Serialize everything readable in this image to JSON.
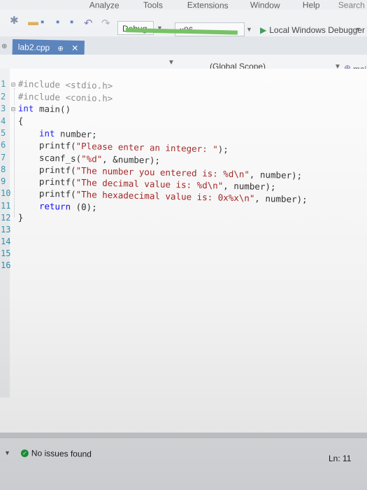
{
  "menu": {
    "items": [
      "Analyze",
      "Tools",
      "Extensions",
      "Window",
      "Help"
    ],
    "search": "Search"
  },
  "toolbar": {
    "config": "Debug",
    "platform": "x86",
    "run_label": "Local Windows Debugger"
  },
  "tab": {
    "filename": "lab2.cpp",
    "pin": "⊕",
    "close": "✕"
  },
  "navbar": {
    "scope": "(Global Scope)",
    "member": "main()"
  },
  "editor": {
    "line_numbers": [
      "1",
      "2",
      "3",
      "4",
      "5",
      "6",
      "7",
      "8",
      "9",
      "10",
      "11",
      "12",
      "13",
      "14",
      "15",
      "16"
    ],
    "lines": [
      {
        "code": "#include <stdio.h>"
      },
      {
        "code": "#include <conio.h>"
      },
      {
        "code": "int main()"
      },
      {
        "code": "{"
      },
      {
        "code": "    int number;"
      },
      {
        "code": "    printf(\"Please enter an integer: \");"
      },
      {
        "code": "    scanf_s(\"%d\", &number);"
      },
      {
        "code": "    printf(\"The number you entered is: %d\\n\", number);"
      },
      {
        "code": "    printf(\"The decimal value is: %d\\n\", number);"
      },
      {
        "code": "    printf(\"The hexadecimal value is: 0x%x\\n\", number);"
      },
      {
        "code": "    return (0);"
      },
      {
        "code": "}"
      }
    ]
  },
  "status": {
    "issues": "No issues found",
    "position": "Ln: 11"
  },
  "colors": {
    "keyword": "#0000ff",
    "string": "#a31515",
    "preproc": "#808080",
    "tab": "#3f6fb3",
    "ok": "#1f9d3c"
  }
}
